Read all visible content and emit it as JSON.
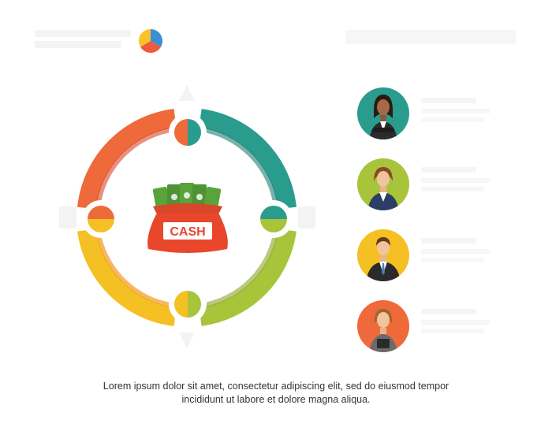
{
  "caption": {
    "line1": "Lorem ipsum dolor sit amet, consectetur adipiscing elit, sed do eiusmod tempor",
    "line2": "incididunt ut labore et dolore magna aliqua."
  },
  "center": {
    "bag_label": "CASH"
  },
  "colors": {
    "teal": "#2a9c8e",
    "teal_dark": "#1f7f73",
    "lime": "#a8c43a",
    "lime_dark": "#8aa52c",
    "yellow": "#f5c023",
    "orange": "#f39a1f",
    "red": "#ef5b34",
    "red_dark": "#d9472a",
    "money": "#5aa33c",
    "bag": "#e8472c"
  },
  "people": [
    {
      "name": "person-1",
      "bg": "#2a9c8e"
    },
    {
      "name": "person-2",
      "bg": "#a8c43a"
    },
    {
      "name": "person-3",
      "bg": "#f5c023"
    },
    {
      "name": "person-4",
      "bg": "#ef6a3a"
    }
  ]
}
